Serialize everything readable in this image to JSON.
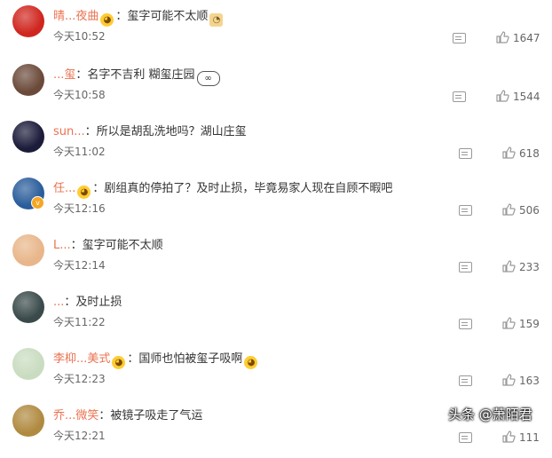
{
  "comments": [
    {
      "user": "晴...夜曲",
      "text": "玺字可能不太顺",
      "emoji_before": "face",
      "emoji_after": "doge",
      "time": "今天10:52",
      "likes": "1647",
      "avatar_color": "#d0261f"
    },
    {
      "user": "...玺",
      "text": "名字不吉利 糊玺庄园",
      "emoji_before": "",
      "emoji_after": "glasses",
      "time": "今天10:58",
      "likes": "1544",
      "avatar_color": "#6b4a3a"
    },
    {
      "user": "sun...",
      "text": "所以是胡乱洗地吗？湖山庄玺",
      "emoji_before": "",
      "emoji_after": "",
      "time": "今天11:02",
      "likes": "618",
      "avatar_color": "#1b1b3a"
    },
    {
      "user": "任...",
      "text": "剧组真的停拍了？及时止损，毕竟易家人现在自顾不暇吧",
      "emoji_before": "face",
      "emoji_after": "",
      "time": "今天12:16",
      "likes": "506",
      "avatar_color": "#2a5d9b"
    },
    {
      "user": "L...",
      "text": "玺字可能不太顺",
      "emoji_before": "",
      "emoji_after": "",
      "time": "今天12:14",
      "likes": "233",
      "avatar_color": "#e8b68a"
    },
    {
      "user": "...",
      "text": "及时止损",
      "emoji_before": "",
      "emoji_after": "",
      "time": "今天11:22",
      "likes": "159",
      "avatar_color": "#3a4a4a"
    },
    {
      "user": "李枊...美式",
      "text": "国师也怕被玺子吸啊",
      "emoji_before": "face",
      "emoji_after": "face",
      "time": "今天12:23",
      "likes": "163",
      "avatar_color": "#c9dcc0"
    },
    {
      "user": "乔...微笑",
      "text": "被镜子吸走了气运",
      "emoji_before": "",
      "emoji_after": "",
      "time": "今天12:21",
      "likes": "111",
      "avatar_color": "#b08a40"
    }
  ],
  "watermark": "头条 @萧陌君",
  "colors": {
    "username": "#eb7350",
    "text": "#333333",
    "meta": "#666666"
  }
}
